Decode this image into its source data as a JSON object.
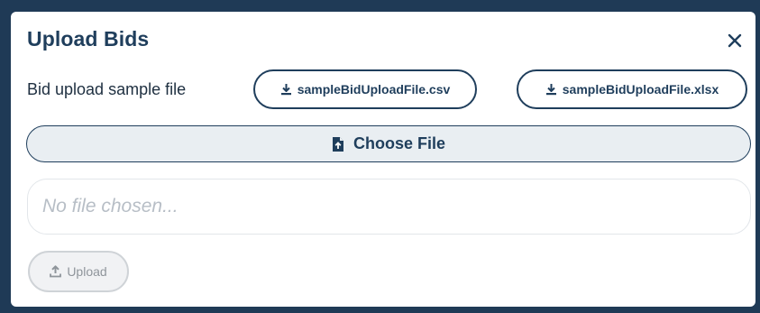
{
  "modal": {
    "title": "Upload Bids",
    "close_icon": "close-icon"
  },
  "sample": {
    "label": "Bid upload sample file",
    "csv_button": {
      "label": "sampleBidUploadFile.csv",
      "icon": "download-icon"
    },
    "xlsx_button": {
      "label": "sampleBidUploadFile.xlsx",
      "icon": "download-icon"
    }
  },
  "choose_file": {
    "label": "Choose File",
    "icon": "file-upload-icon"
  },
  "file_field": {
    "placeholder": "No file chosen..."
  },
  "upload_button": {
    "label": "Upload",
    "icon": "upload-icon",
    "state": "disabled"
  },
  "colors": {
    "primary": "#1f3e5c",
    "backdrop": "#1f3a56",
    "choose_bg": "#e9eef2",
    "disabled_text": "#8f959b"
  }
}
